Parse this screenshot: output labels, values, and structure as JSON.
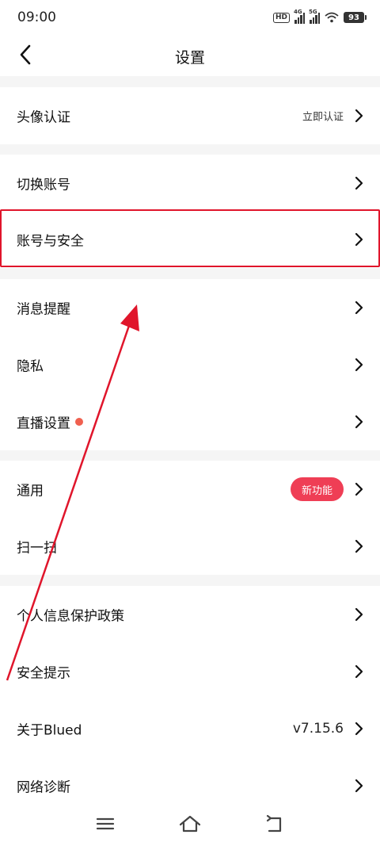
{
  "status_bar": {
    "time": "09:00",
    "hd_label": "HD",
    "net1": "4G",
    "net2": "5G",
    "battery": "93"
  },
  "header": {
    "title": "设置"
  },
  "settings": {
    "avatar_verify": {
      "label": "头像认证",
      "value": "立即认证"
    },
    "switch_account": {
      "label": "切换账号"
    },
    "account_security": {
      "label": "账号与安全"
    },
    "notifications": {
      "label": "消息提醒"
    },
    "privacy": {
      "label": "隐私"
    },
    "live_settings": {
      "label": "直播设置"
    },
    "general": {
      "label": "通用",
      "badge": "新功能"
    },
    "scan": {
      "label": "扫一扫"
    },
    "privacy_policy": {
      "label": "个人信息保护政策"
    },
    "safety_tips": {
      "label": "安全提示"
    },
    "about": {
      "label": "关于Blued",
      "value": "v7.15.6"
    },
    "network_diag": {
      "label": "网络诊断"
    }
  },
  "colors": {
    "accent_red": "#e0152b",
    "badge": "#ef3e55",
    "dot": "#f0604f",
    "separator": "#f5f5f5"
  },
  "icons": [
    "back-icon",
    "chevron-right-icon",
    "menu-icon",
    "home-icon",
    "return-icon"
  ]
}
